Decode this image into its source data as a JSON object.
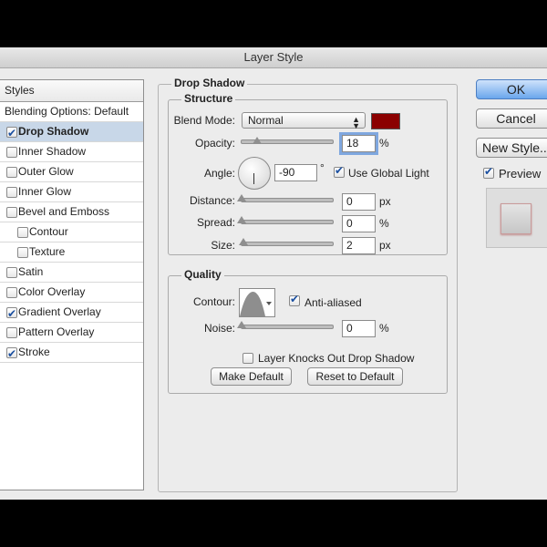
{
  "window": {
    "title": "Layer Style"
  },
  "styles_panel": {
    "header": "Styles",
    "items": [
      {
        "label": "Blending Options: Default",
        "checkbox": false,
        "checked": false,
        "bold": false,
        "selected": false,
        "indent": false
      },
      {
        "label": "Drop Shadow",
        "checkbox": true,
        "checked": true,
        "bold": true,
        "selected": true,
        "indent": false
      },
      {
        "label": "Inner Shadow",
        "checkbox": true,
        "checked": false,
        "bold": false,
        "selected": false,
        "indent": false
      },
      {
        "label": "Outer Glow",
        "checkbox": true,
        "checked": false,
        "bold": false,
        "selected": false,
        "indent": false
      },
      {
        "label": "Inner Glow",
        "checkbox": true,
        "checked": false,
        "bold": false,
        "selected": false,
        "indent": false
      },
      {
        "label": "Bevel and Emboss",
        "checkbox": true,
        "checked": false,
        "bold": false,
        "selected": false,
        "indent": false
      },
      {
        "label": "Contour",
        "checkbox": true,
        "checked": false,
        "bold": false,
        "selected": false,
        "indent": true
      },
      {
        "label": "Texture",
        "checkbox": true,
        "checked": false,
        "bold": false,
        "selected": false,
        "indent": true
      },
      {
        "label": "Satin",
        "checkbox": true,
        "checked": false,
        "bold": false,
        "selected": false,
        "indent": false
      },
      {
        "label": "Color Overlay",
        "checkbox": true,
        "checked": false,
        "bold": false,
        "selected": false,
        "indent": false
      },
      {
        "label": "Gradient Overlay",
        "checkbox": true,
        "checked": true,
        "bold": false,
        "selected": false,
        "indent": false
      },
      {
        "label": "Pattern Overlay",
        "checkbox": true,
        "checked": false,
        "bold": false,
        "selected": false,
        "indent": false
      },
      {
        "label": "Stroke",
        "checkbox": true,
        "checked": true,
        "bold": false,
        "selected": false,
        "indent": false
      }
    ]
  },
  "drop_shadow": {
    "title": "Drop Shadow",
    "structure": {
      "title": "Structure",
      "blend_mode_label": "Blend Mode:",
      "blend_mode_value": "Normal",
      "shadow_color": "#8b0000",
      "opacity_label": "Opacity:",
      "opacity_value": "18",
      "opacity_unit": "%",
      "opacity_level": 0.18,
      "angle_label": "Angle:",
      "angle_value": "-90",
      "angle_unit": "°",
      "use_global_light_label": "Use Global Light",
      "use_global_light_checked": true,
      "distance_label": "Distance:",
      "distance_value": "0",
      "distance_unit": "px",
      "spread_label": "Spread:",
      "spread_value": "0",
      "spread_unit": "%",
      "size_label": "Size:",
      "size_value": "2",
      "size_unit": "px"
    },
    "quality": {
      "title": "Quality",
      "contour_label": "Contour:",
      "anti_aliased_label": "Anti-aliased",
      "anti_aliased_checked": true,
      "noise_label": "Noise:",
      "noise_value": "0",
      "noise_unit": "%"
    },
    "knockout_label": "Layer Knocks Out Drop Shadow",
    "knockout_checked": false,
    "make_default_label": "Make Default",
    "reset_default_label": "Reset to Default"
  },
  "actions": {
    "ok_label": "OK",
    "cancel_label": "Cancel",
    "new_style_label": "New Style...",
    "preview_label": "Preview",
    "preview_checked": true
  },
  "colors": {
    "accent": "#6aa6ec",
    "selection": "#c8d7e8"
  }
}
